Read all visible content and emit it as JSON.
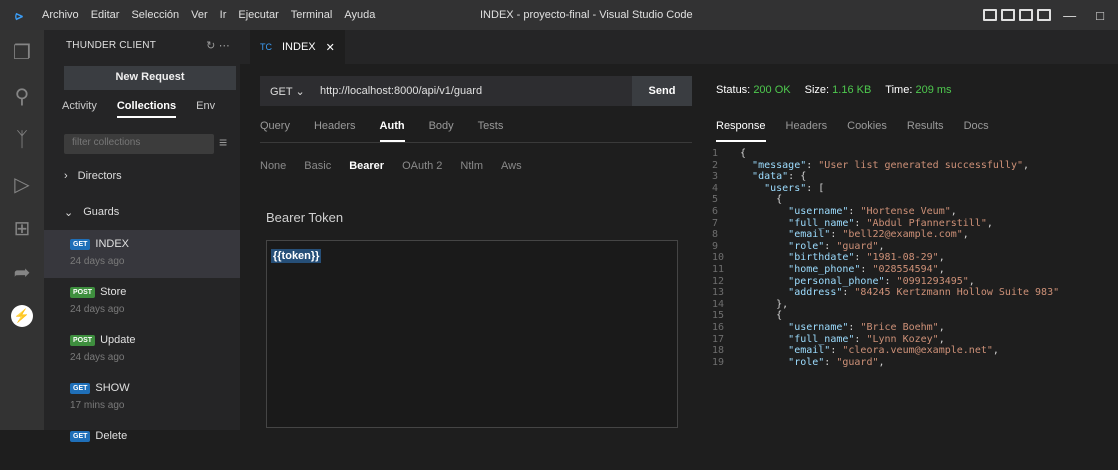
{
  "titlebar": {
    "menu": [
      "Archivo",
      "Editar",
      "Selección",
      "Ver",
      "Ir",
      "Ejecutar",
      "Terminal",
      "Ayuda"
    ],
    "window_title": "INDEX - proyecto-final - Visual Studio Code",
    "accent": "#3b9cf5"
  },
  "sidebar": {
    "header": "THUNDER CLIENT",
    "new_request": "New Request",
    "tabs": [
      "Activity",
      "Collections",
      "Env"
    ],
    "active_tab": "Collections",
    "filter_placeholder": "filter collections",
    "folders": [
      "Directors",
      "Guards"
    ],
    "requests": [
      {
        "method": "GET",
        "name": "INDEX",
        "time": "24 days ago"
      },
      {
        "method": "POST",
        "name": "Store",
        "time": "24 days ago"
      },
      {
        "method": "POST",
        "name": "Update",
        "time": "24 days ago"
      },
      {
        "method": "GET",
        "name": "SHOW",
        "time": "17 mins ago"
      },
      {
        "method": "GET",
        "name": "Delete",
        "time": ""
      }
    ]
  },
  "editor": {
    "tab_label": "INDEX",
    "method": "GET",
    "url": "http://localhost:8000/api/v1/guard",
    "send_label": "Send",
    "request_tabs": [
      "Query",
      "Headers",
      "Auth",
      "Body",
      "Tests"
    ],
    "auth_tabs": [
      "None",
      "Basic",
      "Bearer",
      "OAuth 2",
      "Ntlm",
      "Aws"
    ],
    "bearer_label": "Bearer Token",
    "token_value": "{{token}}"
  },
  "response": {
    "status_label": "Status:",
    "status_value": "200 OK",
    "size_label": "Size:",
    "size_value": "1.16 KB",
    "time_label": "Time:",
    "time_value": "209 ms",
    "tabs": [
      "Response",
      "Headers",
      "Cookies",
      "Results",
      "Docs"
    ],
    "lines": [
      {
        "n": "1",
        "t": "{"
      },
      {
        "n": "2",
        "t": "  \"message\": \"User list generated successfully\","
      },
      {
        "n": "3",
        "t": "  \"data\": {"
      },
      {
        "n": "4",
        "t": "    \"users\": ["
      },
      {
        "n": "5",
        "t": "      {"
      },
      {
        "n": "6",
        "t": "        \"username\": \"Hortense Veum\","
      },
      {
        "n": "7",
        "t": "        \"full_name\": \"Abdul Pfannerstill\","
      },
      {
        "n": "8",
        "t": "        \"email\": \"bell22@example.com\","
      },
      {
        "n": "9",
        "t": "        \"role\": \"guard\","
      },
      {
        "n": "10",
        "t": "        \"birthdate\": \"1981-08-29\","
      },
      {
        "n": "11",
        "t": "        \"home_phone\": \"028554594\","
      },
      {
        "n": "12",
        "t": "        \"personal_phone\": \"0991293495\","
      },
      {
        "n": "13",
        "t": "        \"address\": \"84245 Kertzmann Hollow Suite 983\""
      },
      {
        "n": "14",
        "t": "      },"
      },
      {
        "n": "15",
        "t": "      {"
      },
      {
        "n": "16",
        "t": "        \"username\": \"Brice Boehm\","
      },
      {
        "n": "17",
        "t": "        \"full_name\": \"Lynn Kozey\","
      },
      {
        "n": "18",
        "t": "        \"email\": \"cleora.veum@example.net\","
      },
      {
        "n": "19",
        "t": "        \"role\": \"guard\","
      }
    ]
  }
}
